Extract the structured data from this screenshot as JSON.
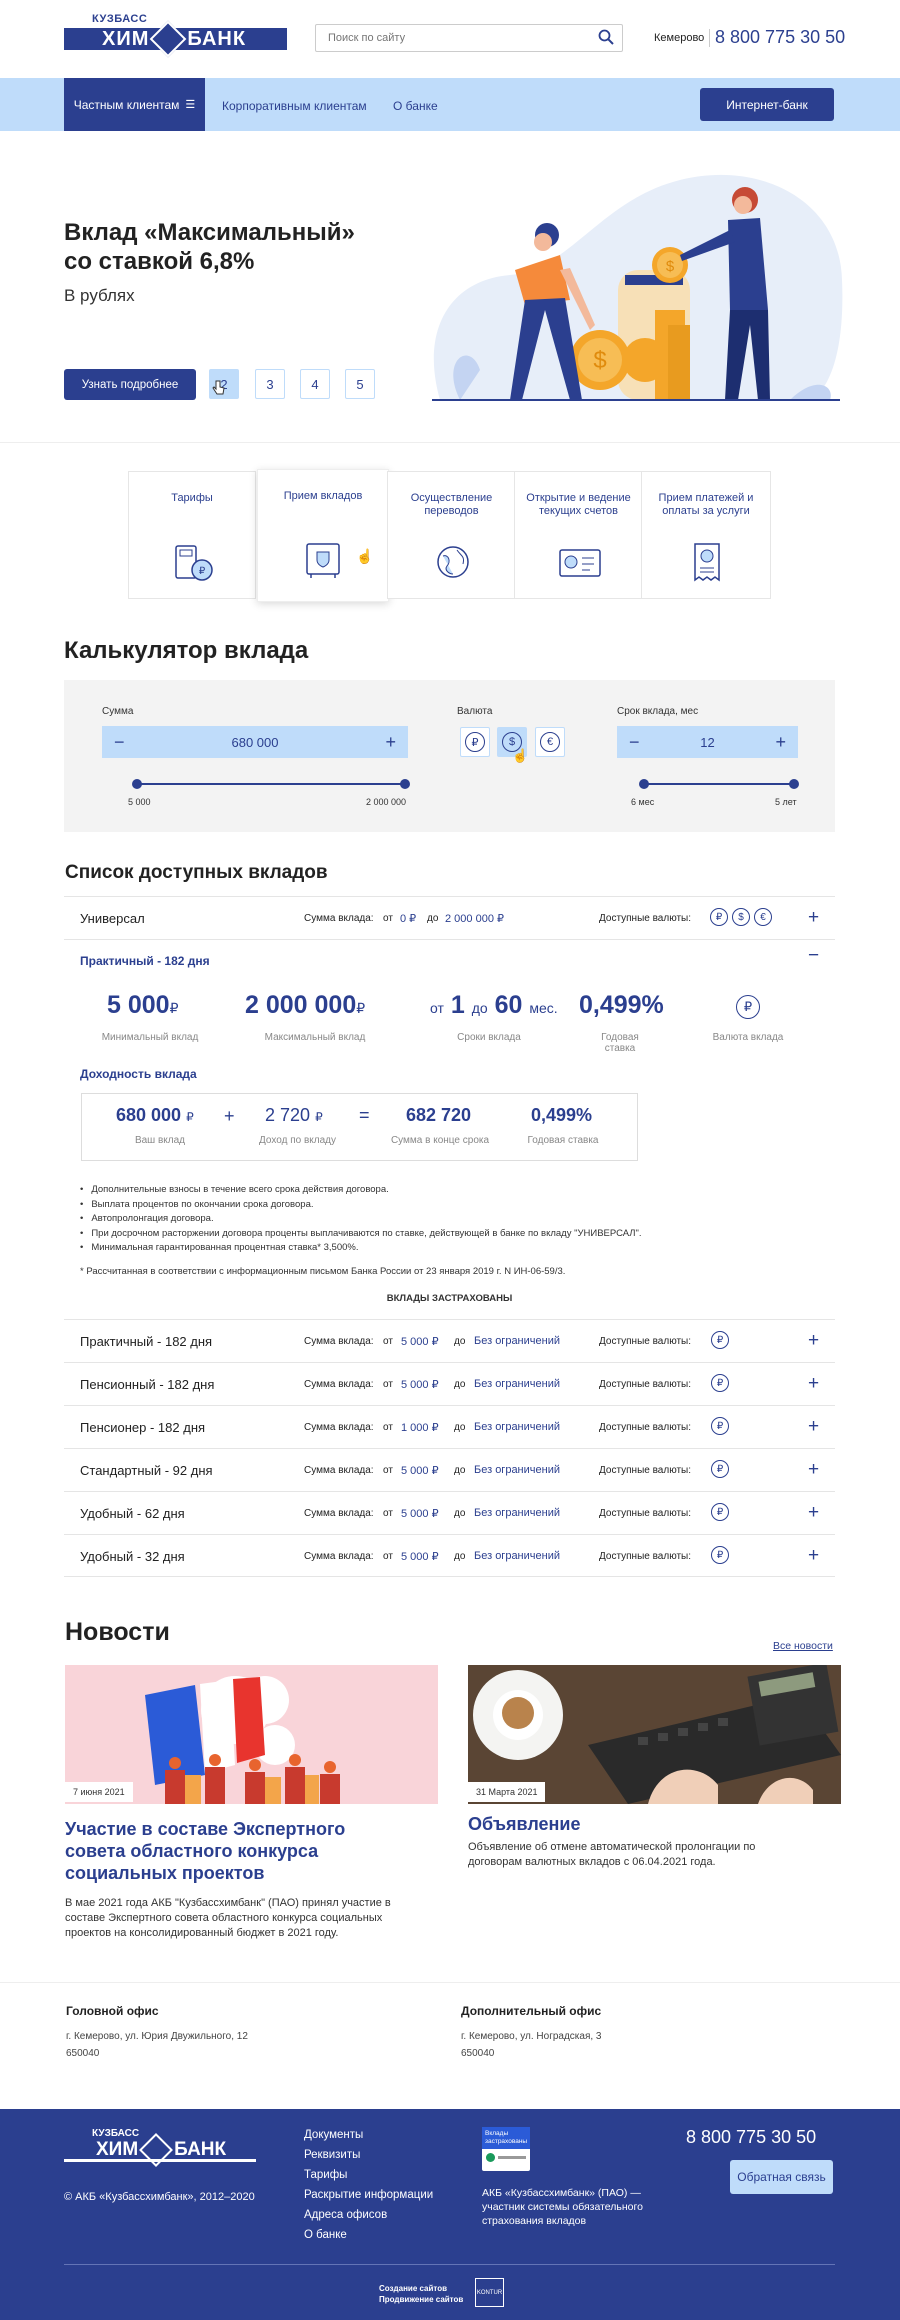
{
  "header": {
    "logo_top": "КУЗБАСС",
    "logo_left": "ХИМ",
    "logo_right": "БАНК",
    "search_placeholder": "Поиск по сайту",
    "city": "Кемерово",
    "phone": "8 800 775 30 50"
  },
  "nav": {
    "items": [
      "Частным клиентам",
      "Корпоративным клиентам",
      "О банке"
    ],
    "internet_bank": "Интернет-банк"
  },
  "hero": {
    "title_line1": "Вклад «Максимальный»",
    "title_line2": "со ставкой 6,8%",
    "subtitle": "В рублях",
    "button": "Узнать подробнее",
    "pages": [
      "2",
      "3",
      "4",
      "5"
    ]
  },
  "services": [
    {
      "label": "Тарифы",
      "icon": "calculator-coins-icon"
    },
    {
      "label": "Прием вкладов",
      "icon": "safe-icon"
    },
    {
      "label": "Осуществление переводов",
      "icon": "globe-transfer-icon"
    },
    {
      "label": "Открытие и ведение текущих счетов",
      "icon": "account-card-icon"
    },
    {
      "label": "Прием платежей и оплаты за услуги",
      "icon": "receipt-icon"
    }
  ],
  "calculator": {
    "title": "Калькулятор вклада",
    "sum_label": "Сумма",
    "sum_value": "680 000",
    "sum_min": "5 000",
    "sum_max": "2 000 000",
    "currency_label": "Валюта",
    "currencies": [
      "₽",
      "$",
      "€"
    ],
    "selected_currency": "$",
    "term_label": "Срок вклада, мес",
    "term_value": "12",
    "term_min": "6 мес",
    "term_max": "5 лет"
  },
  "deposits": {
    "title": "Список доступных вкладов",
    "sum_label": "Сумма вклада:",
    "from": "от",
    "to": "до",
    "currencies_label": "Доступные валюты:",
    "universal": {
      "name": "Универсал",
      "min": "0 ₽",
      "max": "2 000 000 ₽",
      "currencies": [
        "₽",
        "$",
        "€"
      ]
    },
    "expanded": {
      "name": "Практичный - 182 дня",
      "min_amount": "5 000",
      "min_caption": "Минимальный вклад",
      "max_amount": "2 000 000",
      "max_caption": "Максимальный вклад",
      "term_from_word": "от",
      "term_from": "1",
      "term_to_word": "до",
      "term_to": "60",
      "term_unit": "мес.",
      "term_caption": "Сроки вклада",
      "rate": "0,499%",
      "rate_caption": "Годовая ставка",
      "currency_caption": "Валюта вклада",
      "ruble_sign": "₽",
      "yield_title": "Доходность вклада",
      "y_deposit": "680 000",
      "y_deposit_caption": "Ваш вклад",
      "y_income": "2 720",
      "y_income_caption": "Доход по вкладу",
      "y_total": "682 720",
      "y_total_caption": "Сумма в конце срока",
      "y_rate": "0,499%",
      "y_rate_caption": "Годовая ставка",
      "plus_sign": "+",
      "equals_sign": "=",
      "bullets": [
        "Дополнительные взносы в течение всего срока действия договора.",
        "Выплата процентов по окончании срока договора.",
        "Автопролонгация договора.",
        "При досрочном расторжении договора проценты выплачиваются по ставке, действующей в банке по вкладу \"УНИВЕРСАЛ\".",
        "Минимальная гарантированная процентная ставка* 3,500%."
      ],
      "footnote": "* Рассчитанная в соответствии с информационным письмом Банка России от 23 января 2019 г. N ИН-06-59/3.",
      "insured": "ВКЛАДЫ ЗАСТРАХОВАНЫ"
    },
    "rows": [
      {
        "name": "Практичный - 182 дня",
        "min": "5 000 ₽",
        "max": "Без ограничений"
      },
      {
        "name": "Пенсионный - 182 дня",
        "min": "5 000 ₽",
        "max": "Без ограничений"
      },
      {
        "name": "Пенсионер - 182 дня",
        "min": "1 000 ₽",
        "max": "Без ограничений"
      },
      {
        "name": "Стандартный - 92 дня",
        "min": "5 000 ₽",
        "max": "Без ограничений"
      },
      {
        "name": "Удобный - 62 дня",
        "min": "5 000 ₽",
        "max": "Без ограничений"
      },
      {
        "name": "Удобный - 32 дня",
        "min": "5 000 ₽",
        "max": "Без ограничений"
      }
    ]
  },
  "news": {
    "title": "Новости",
    "all_link": "Все новости",
    "items": [
      {
        "date": "7 июня 2021",
        "title": "Участие в составе Экспертного совета областного конкурса социальных проектов",
        "text": "В мае 2021 года АКБ \"Кузбассхимбанк\" (ПАО) принял участие  в составе Экспертного совета областного конкурса социальных проектов на консолидированный бюджет в 2021 году."
      },
      {
        "date": "31 Марта 2021",
        "title": "Объявление",
        "text": "Объявление об отмене автоматической пролонгации по договорам валютных вкладов с 06.04.2021 года."
      }
    ]
  },
  "offices": {
    "main_title": "Головной офис",
    "main_addr": "г. Кемерово, ул. Юрия Двужильного, 12",
    "main_zip": "650040",
    "add_title": "Дополнительный офис",
    "add_addr": "г. Кемерово, ул. Ноградская, 3",
    "add_zip": "650040"
  },
  "footer": {
    "copyright": "© АКБ «Кузбассхимбанк», 2012–2020",
    "links": [
      "Документы",
      "Реквизиты",
      "Тарифы",
      "Раскрытие информации",
      "Адреса офисов",
      "О банке"
    ],
    "insurance_badge_line1": "Вклады",
    "insurance_badge_line2": "застрахованы",
    "insurance_text": "АКБ «Кузбассхимбанк» (ПАО) — участник системы обязательного страхования вкладов",
    "phone": "8 800 775 30 50",
    "feedback": "Обратная связь",
    "dev_line1": "Создание сайтов",
    "dev_line2": "Продвижение сайтов",
    "dev_logo": "KONTUR"
  },
  "colors": {
    "brand": "#2b3f8f",
    "light": "#bfdcfa",
    "accent": "#f4a62a"
  }
}
